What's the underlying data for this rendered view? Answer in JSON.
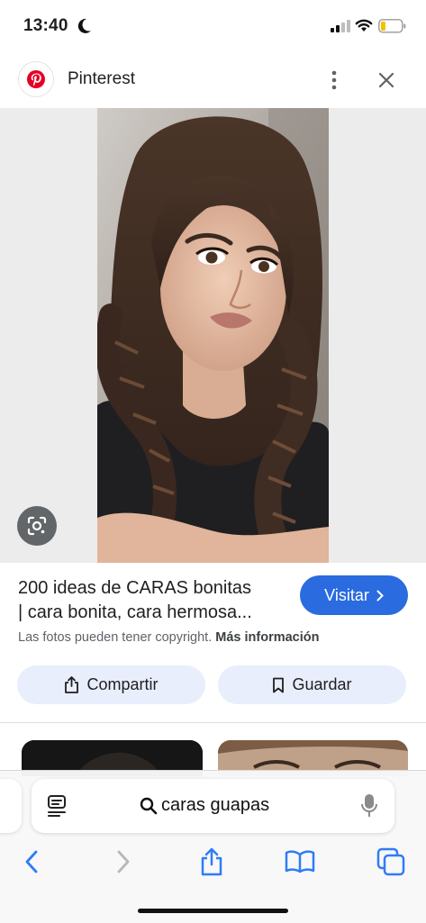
{
  "status_bar": {
    "time": "13:40"
  },
  "header": {
    "site_name": "Pinterest",
    "brand_color": "#e60023"
  },
  "result": {
    "title_line1": "200 ideas de CARAS bonitas",
    "title_line2": "| cara bonita, cara hermosa...",
    "visit_label": "Visitar",
    "copyright_text": "Las fotos pueden tener copyright.",
    "more_info_label": "Más información",
    "share_label": "Compartir",
    "save_label": "Guardar"
  },
  "address_bar": {
    "query": "caras guapas"
  },
  "colors": {
    "accent": "#2a6be0",
    "action_bg": "#e8eefc",
    "safari_blue": "#2f7cf6"
  }
}
